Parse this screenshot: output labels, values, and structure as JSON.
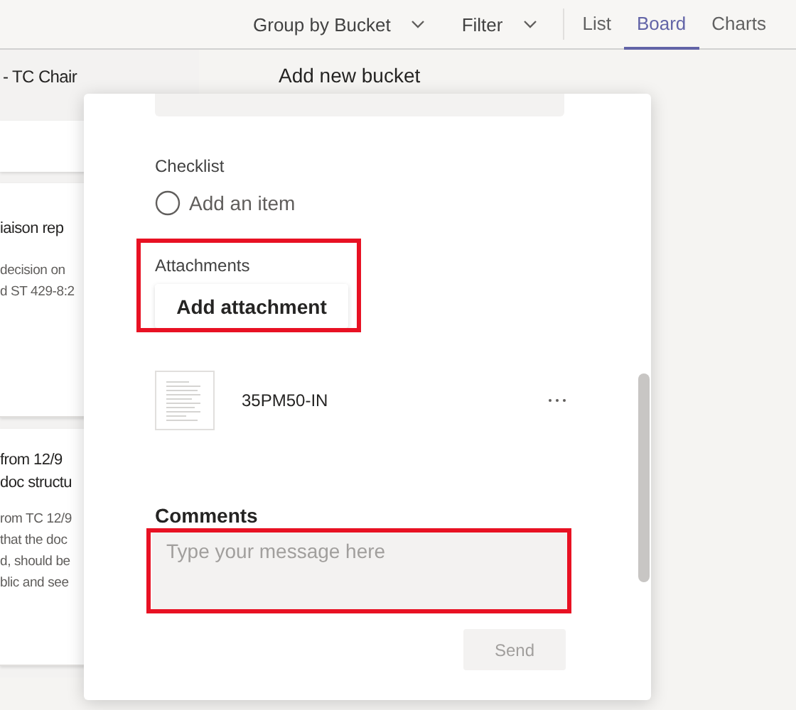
{
  "toolbar": {
    "menus": [
      {
        "label": "Group by Bucket"
      },
      {
        "label": "Filter"
      }
    ],
    "views": [
      {
        "label": "List",
        "selected": false
      },
      {
        "label": "Board",
        "selected": true
      },
      {
        "label": "Charts",
        "selected": false
      }
    ]
  },
  "board": {
    "bucket_title": "- TC Chair",
    "add_bucket": "Add new bucket",
    "cards": [
      {
        "title_lines": [
          "iaison rep"
        ],
        "body_lines": [
          "decision on",
          "d ST 429-8:2"
        ]
      },
      {
        "title_lines": [
          "from 12/9",
          "doc structu"
        ],
        "body_lines": [
          "rom TC 12/9",
          "that the doc",
          "d, should be",
          "blic and see"
        ]
      }
    ]
  },
  "task": {
    "checklist": {
      "label": "Checklist",
      "placeholder": "Add an item"
    },
    "attachments": {
      "label": "Attachments",
      "button": "Add attachment",
      "highlighted": true,
      "files": [
        {
          "name": "35PM50-IN"
        }
      ]
    },
    "comments": {
      "label": "Comments",
      "placeholder": "Type your message here",
      "highlighted": true,
      "send": {
        "label": "Send",
        "disabled": true
      }
    }
  }
}
